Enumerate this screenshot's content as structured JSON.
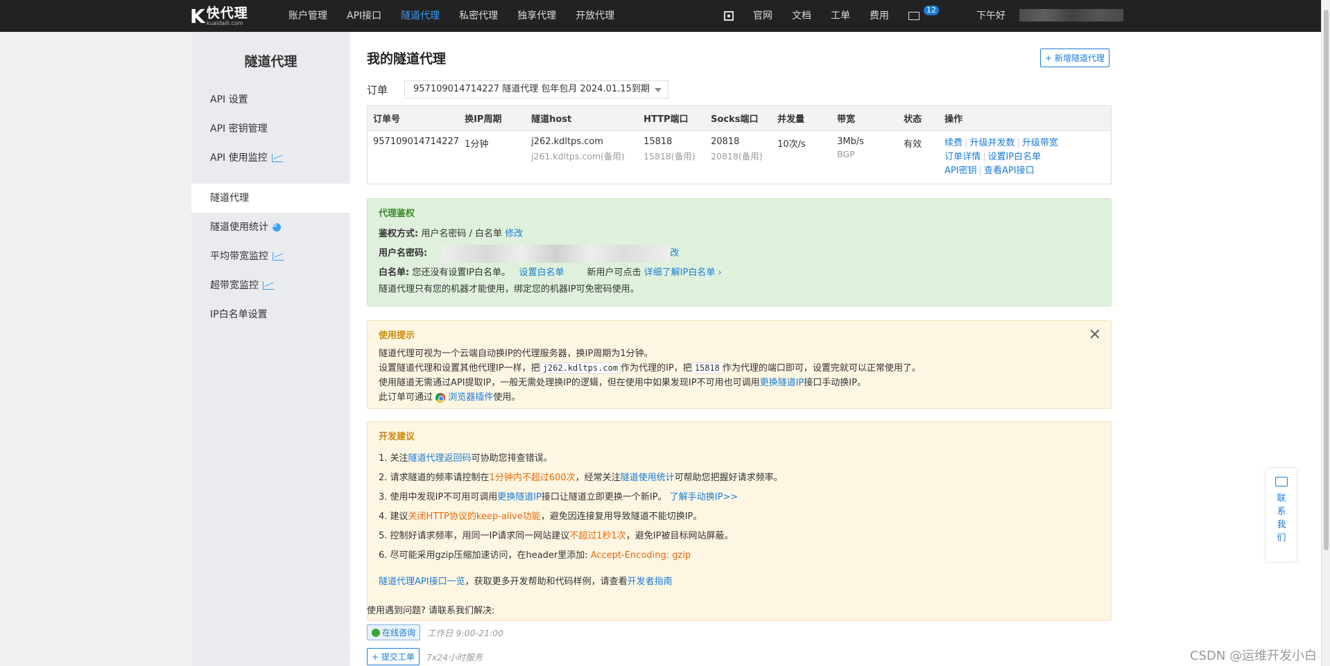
{
  "topbar": {
    "logo_text": "快代理",
    "logo_sub": "kuaidaili.com",
    "nav": [
      "账户管理",
      "API接口",
      "隧道代理",
      "私密代理",
      "独享代理",
      "开放代理"
    ],
    "active_nav": "隧道代理",
    "right": [
      "官网",
      "文档",
      "工单",
      "费用"
    ],
    "mail_badge": "12",
    "greeting": "下午好"
  },
  "sidebar": {
    "title": "隧道代理",
    "items": [
      "API 设置",
      "API 密钥管理",
      "API 使用监控",
      "隧道代理",
      "隧道使用统计",
      "平均带宽监控",
      "超带宽监控",
      "IP白名单设置"
    ]
  },
  "main": {
    "title": "我的隧道代理",
    "new_button": "+ 新增隧道代理",
    "order_label": "订单",
    "order_value": "957109014714227  隧道代理  包年包月  2024.01.15到期",
    "table": {
      "headers": [
        "订单号",
        "换IP周期",
        "隧道host",
        "HTTP端口",
        "Socks端口",
        "并发量",
        "带宽",
        "状态",
        "操作"
      ],
      "row": {
        "order_no": "957109014714227",
        "cycle": "1分钟",
        "host": "j262.kdltps.com",
        "host_backup": "j261.kdltps.com(备用)",
        "http_port": "15818",
        "http_port_backup": "15818(备用)",
        "socks_port": "20818",
        "socks_port_backup": "20818(备用)",
        "concurrency": "10次/s",
        "bandwidth": "3Mb/s",
        "bandwidth_sub": "BGP",
        "status": "有效",
        "ops": [
          "续费",
          "升级并发数",
          "升级带宽",
          "订单详情",
          "设置IP白名单",
          "API密钥",
          "查看API接口"
        ]
      }
    },
    "auth": {
      "title": "代理鉴权",
      "method_label": "鉴权方式:",
      "method_value": "用户名密码 / 白名单",
      "method_link": "修改",
      "cred_label": "用户名密码:",
      "cred_link": "改",
      "whitelist_label": "白名单:",
      "whitelist_text": "您还没有设置IP白名单。",
      "whitelist_link": "设置白名单",
      "new_user_text": "新用户可点击",
      "new_user_link": "详细了解IP白名单 ›",
      "note": "隧道代理只有您的机器才能使用，绑定您的机器IP可免密码使用。"
    },
    "tip": {
      "title": "使用提示",
      "line1": "隧道代理可视为一个云端自动换IP的代理服务器，换IP周期为1分钟。",
      "line2a": "设置隧道代理和设置其他代理IP一样，把",
      "line2_code1": "j262.kdltps.com",
      "line2b": "作为代理的IP，把",
      "line2_code2": "15818",
      "line2c": "作为代理的端口即可，设置完就可以正常使用了。",
      "line3a": "使用隧道无需通过API提取IP，一般无需处理换IP的逻辑，但在使用中如果发现IP不可用也可调用",
      "line3_link": "更换隧道IP",
      "line3b": "接口手动换IP。",
      "line4a": "此订单可通过",
      "line4_link": "浏览器插件",
      "line4b": "使用。"
    },
    "dev": {
      "title": "开发建议",
      "l1a": "1. 关注",
      "l1_link": "隧道代理返回码",
      "l1b": "可协助您排查错误。",
      "l2a": "2. 请求隧道的频率请控制在",
      "l2_hl": "1分钟内不超过600次",
      "l2b": "，经常关注",
      "l2_link": "隧道使用统计",
      "l2c": "可帮助您把握好请求频率。",
      "l3a": "3. 使用中发现IP不可用可调用",
      "l3_link": "更换隧道IP",
      "l3b": "接口让隧道立即更换一个新IP。",
      "l3_link2": "了解手动换IP>>",
      "l4a": "4. 建议",
      "l4_hl": "关闭HTTP协议的keep-alive功能",
      "l4b": "，避免因连接复用导致隧道不能切换IP。",
      "l5a": "5. 控制好请求频率，用同一IP请求同一网站建议",
      "l5_hl": "不超过1秒1次",
      "l5b": "，避免IP被目标网站屏蔽。",
      "l6a": "6. 尽可能采用gzip压缩加速访问，在header里添加:",
      "l6_hl": "Accept-Encoding: gzip",
      "foot_link": "隧道代理API接口一览",
      "foot_text": "，获取更多开发帮助和代码样例，请查看",
      "foot_link2": "开发者指南"
    },
    "help": {
      "question": "使用遇到问题? 请联系我们解决:",
      "chat_btn": "在线咨询",
      "chat_hours": "工作日 9:00-21:00",
      "ticket_btn": "+ 提交工单",
      "ticket_hours": "7x24小时服务"
    }
  },
  "contact": {
    "chars": [
      "联",
      "系",
      "我",
      "们"
    ]
  },
  "watermark": "CSDN @运维开发小白",
  "colors": {
    "topbar": "#222222",
    "link": "#1a7bd6",
    "highlight": "#e8690c",
    "auth_bg": "#dff1dc",
    "tip_bg": "#fdf6e3"
  }
}
